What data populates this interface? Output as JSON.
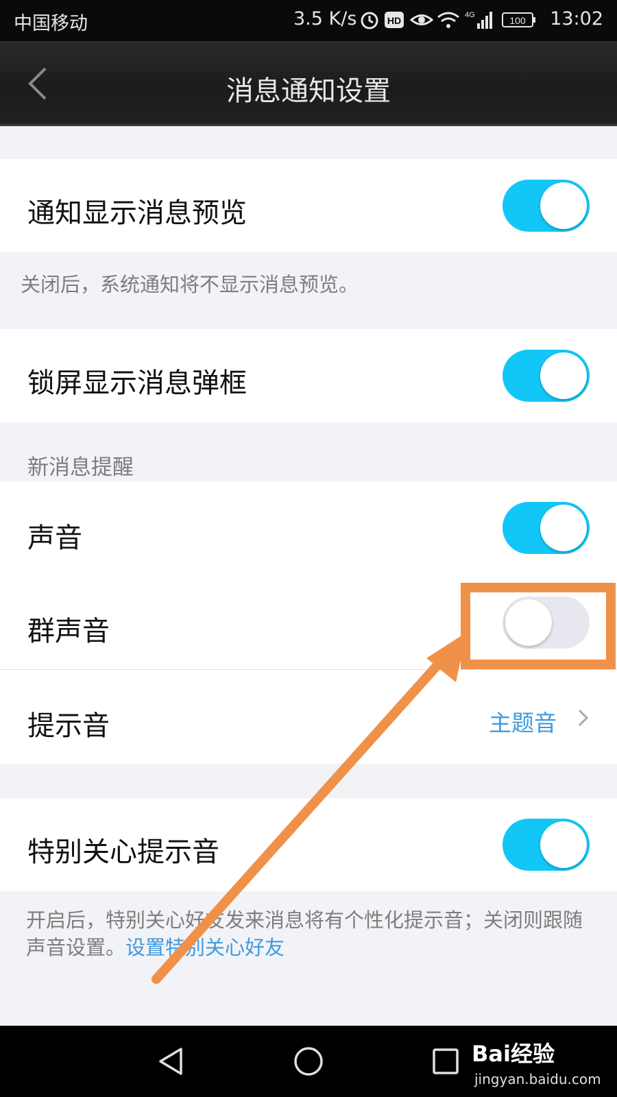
{
  "status_bar": {
    "carrier": "中国移动",
    "net_speed": "3.5 K/s",
    "hd_badge": "HD",
    "network_type": "4G",
    "battery": "100",
    "time": "13:02",
    "icons": [
      "alarm-icon",
      "hd-icon",
      "eye-icon",
      "wifi-icon",
      "signal-icon",
      "battery-icon"
    ]
  },
  "header": {
    "title": "消息通知设置",
    "back_icon": "back-chevron-icon"
  },
  "settings": {
    "preview": {
      "label": "通知显示消息预览",
      "enabled": true,
      "hint": "关闭后，系统通知将不显示消息预览。"
    },
    "lockscreen": {
      "label": "锁屏显示消息弹框",
      "enabled": true
    },
    "new_message_section": "新消息提醒",
    "sound": {
      "label": "声音",
      "enabled": true
    },
    "group_sound": {
      "label": "群声音",
      "enabled": false
    },
    "tone": {
      "label": "提示音",
      "value": "主题音"
    },
    "special_care": {
      "label": "特别关心提示音",
      "enabled": true,
      "hint": "开启后，特别关心好友发来消息将有个性化提示音；关闭则跟随声音设置。",
      "link": "设置特别关心好友"
    }
  },
  "nav_bar": {
    "icons": [
      "back-triangle-icon",
      "home-circle-icon",
      "recents-square-icon"
    ]
  },
  "watermark": {
    "brand": "Bai经验",
    "site": "jingyan.baidu.com"
  },
  "colors": {
    "toggle_on": "#12c7f7",
    "toggle_off": "#e7e8ef",
    "link": "#3e9ae0",
    "annotation": "#f0914a"
  }
}
